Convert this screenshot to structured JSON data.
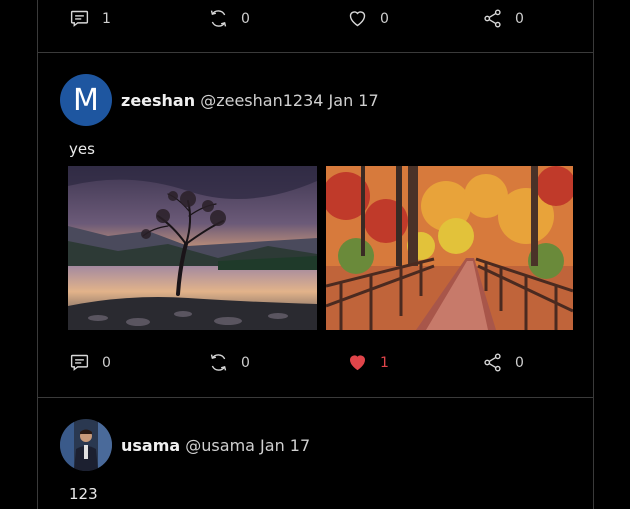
{
  "top_actions": {
    "comments": "1",
    "reposts": "0",
    "likes": "0",
    "shares": "0"
  },
  "posts": [
    {
      "avatar_letter": "M",
      "name": "zeeshan",
      "handle": "@zeeshan1234",
      "date": "Jan 17",
      "text": "yes",
      "images": [
        "lake-tree-sunset",
        "autumn-boardwalk"
      ],
      "actions": {
        "comments": "0",
        "reposts": "0",
        "likes": "1",
        "shares": "0",
        "liked": true
      }
    },
    {
      "avatar_image": "user-photo",
      "name": "usama",
      "handle": "@usama",
      "date": "Jan 17",
      "text": "123"
    }
  ],
  "colors": {
    "background": "#000000",
    "avatar_blue": "#1e56a0",
    "like_red": "#e0454a",
    "border": "#3a3a3a"
  }
}
